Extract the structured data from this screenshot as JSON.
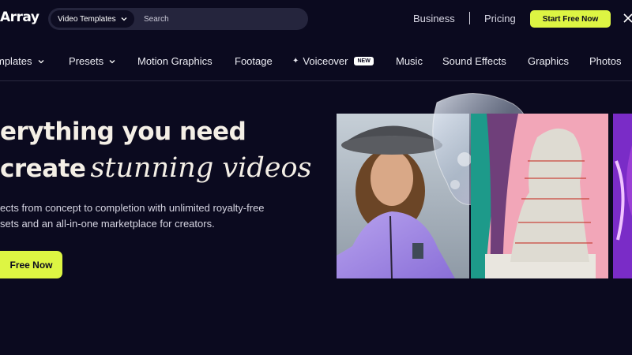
{
  "header": {
    "logo_text": "Array",
    "search": {
      "category": "Video Templates",
      "placeholder": "Search"
    },
    "links": {
      "business": "Business",
      "pricing": "Pricing"
    },
    "cta": "Start Free Now"
  },
  "category_nav": {
    "items": [
      {
        "label": "mplates",
        "has_dropdown": true
      },
      {
        "label": "Presets",
        "has_dropdown": true
      },
      {
        "label": "Motion Graphics"
      },
      {
        "label": "Footage"
      },
      {
        "label": "Voiceover",
        "badge": "NEW",
        "icon": "sparkle-icon"
      },
      {
        "label": "Music"
      },
      {
        "label": "Sound Effects"
      },
      {
        "label": "Graphics"
      },
      {
        "label": "Photos"
      }
    ]
  },
  "hero": {
    "headline_line1": "erything you need",
    "headline_line2_plain": "create",
    "headline_line2_script": "stunning videos",
    "subtext_line1": "ects from concept to completion with unlimited royalty-free",
    "subtext_line2": "sets and an all-in-one marketplace for creators.",
    "cta": "Free Now"
  },
  "colors": {
    "background": "#0b0a1f",
    "accent": "#ddf543",
    "text_cream": "#f4efe6"
  }
}
